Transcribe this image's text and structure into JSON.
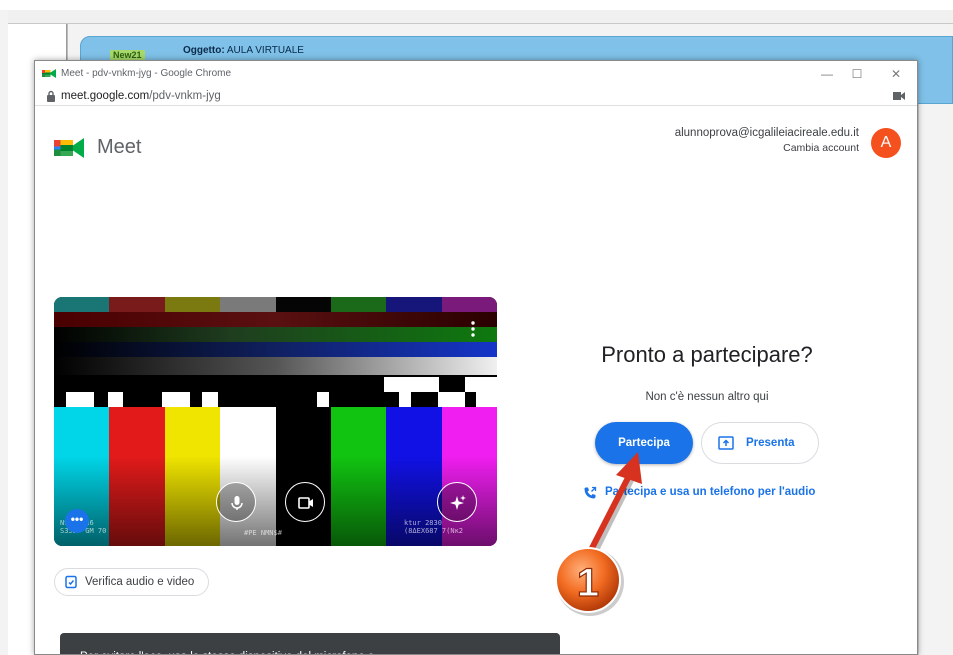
{
  "background_app": {
    "badge": "New21",
    "subject_label": "Oggetto:",
    "subject_value": "AULA VIRTUALE"
  },
  "browser": {
    "window_title": "Meet - pdv-vnkm-jyg - Google Chrome",
    "url_host": "meet.google.com",
    "url_path": "/pdv-vnkm-jyg",
    "controls": {
      "minimize": "—",
      "maximize": "☐",
      "close": "✕"
    }
  },
  "meet": {
    "logo_text": "Meet",
    "account_email": "alunnoprova@icgalileiacireale.edu.it",
    "switch_account": "Cambia account",
    "avatar_letter": "A",
    "ready_title": "Pronto a partecipare?",
    "nobody_here": "Non c'è nessun altro qui",
    "join_button": "Partecipa",
    "present_button": "Presenta",
    "phone_link": "Partecipa e usa un telefono per l'audio",
    "check_av_button": "Verifica audio e video",
    "more_button": "•••",
    "toast": "Per evitare l'eco, usa lo stesso dispositivo del microfono e"
  },
  "annotation": {
    "step_number": "1",
    "color": "#d7311f"
  },
  "colors": {
    "accent": "#1a73e8",
    "avatar": "#f4511e",
    "toast_bg": "#3c4043"
  }
}
